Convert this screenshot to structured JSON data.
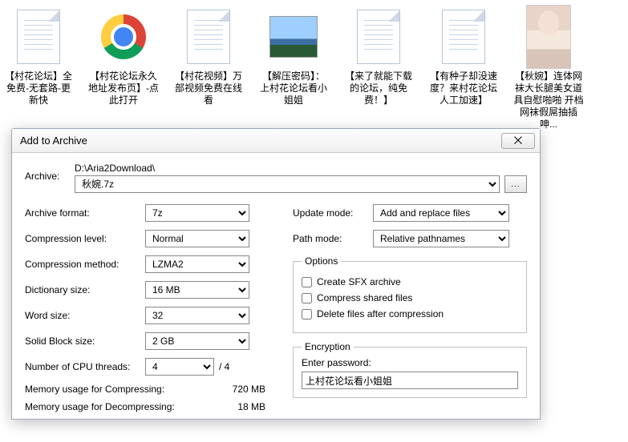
{
  "desktop": {
    "items": [
      {
        "kind": "txt",
        "label": "【村花论坛】全免费-无套路-更新快"
      },
      {
        "kind": "chrome",
        "label": "【村花论坛永久地址发布页】-点此打开"
      },
      {
        "kind": "txt",
        "label": "【村花视频】万部视频免费在线看"
      },
      {
        "kind": "photo",
        "label": "【解压密码】：上村花论坛看小姐姐"
      },
      {
        "kind": "txt",
        "label": "【来了就能下载的论坛，纯免费！】"
      },
      {
        "kind": "txt",
        "label": "【有种子却没速度？来村花论坛人工加速】"
      },
      {
        "kind": "avatar",
        "label": "【秋婉】连体网袜大长腿美女道具自慰啪啪 开档网袜假屌抽插呻..."
      }
    ]
  },
  "dialog": {
    "title": "Add to Archive",
    "closeGlyph": "⨉",
    "archive": {
      "label": "Archive:",
      "path": "D:\\Aria2Download\\",
      "file": "秋婉.7z",
      "browse": "..."
    },
    "left": {
      "format": {
        "label": "Archive format:",
        "value": "7z"
      },
      "level": {
        "label": "Compression level:",
        "value": "Normal"
      },
      "method": {
        "label": "Compression method:",
        "value": "LZMA2"
      },
      "dict": {
        "label": "Dictionary size:",
        "value": "16 MB"
      },
      "word": {
        "label": "Word size:",
        "value": "32"
      },
      "block": {
        "label": "Solid Block size:",
        "value": "2 GB"
      },
      "threads": {
        "label": "Number of CPU threads:",
        "value": "4",
        "suffix": "/ 4"
      },
      "memc": {
        "label": "Memory usage for Compressing:",
        "value": "720 MB"
      },
      "memd": {
        "label": "Memory usage for Decompressing:",
        "value": "18 MB"
      }
    },
    "right": {
      "update": {
        "label": "Update mode:",
        "value": "Add and replace files"
      },
      "pathmode": {
        "label": "Path mode:",
        "value": "Relative pathnames"
      },
      "options": {
        "legend": "Options",
        "sfx": "Create SFX archive",
        "shared": "Compress shared files",
        "delete": "Delete files after compression"
      },
      "enc": {
        "legend": "Encryption",
        "pwlabel": "Enter password:",
        "pwvalue": "上村花论坛看小姐姐"
      }
    }
  }
}
